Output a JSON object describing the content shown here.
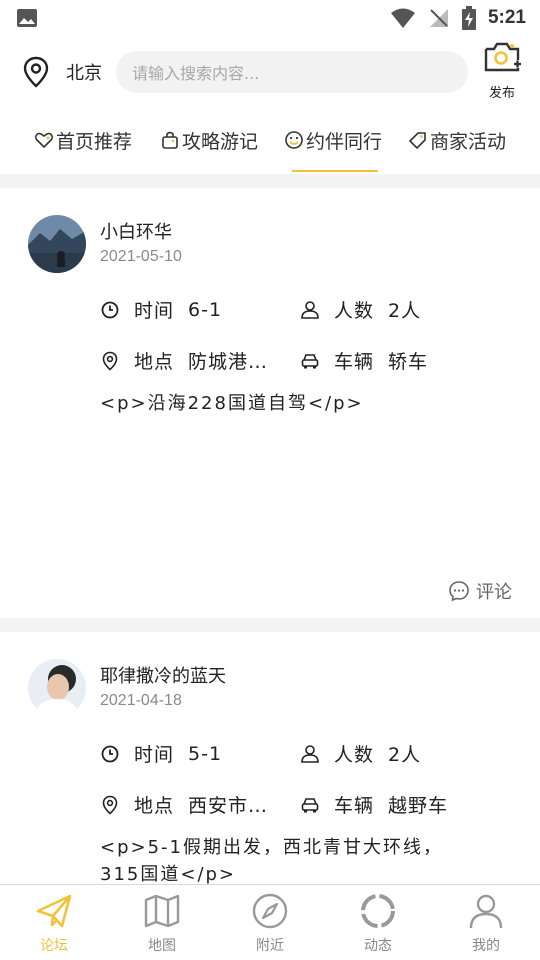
{
  "status_bar": {
    "time": "5:21"
  },
  "header": {
    "city": "北京",
    "search_placeholder": "请输入搜索内容...",
    "publish_label": "发布"
  },
  "tabs": [
    {
      "label": "首页推荐",
      "icon": "heart-icon"
    },
    {
      "label": "攻略游记",
      "icon": "bag-icon"
    },
    {
      "label": "约伴同行",
      "icon": "smile-icon",
      "active": true
    },
    {
      "label": "商家活动",
      "icon": "tag-icon"
    }
  ],
  "posts": [
    {
      "author": "小白环华",
      "date": "2021-05-10",
      "time_label": "时间",
      "time_value": "6-1",
      "people_label": "人数",
      "people_value": "2人",
      "place_label": "地点",
      "place_value": "防城港…",
      "vehicle_label": "车辆",
      "vehicle_value": "轿车",
      "content": "<p>沿海228国道自驾</p>",
      "comment_label": "评论"
    },
    {
      "author": "耶律撒冷的蓝天",
      "date": "2021-04-18",
      "time_label": "时间",
      "time_value": "5-1",
      "people_label": "人数",
      "people_value": "2人",
      "place_label": "地点",
      "place_value": "西安市…",
      "vehicle_label": "车辆",
      "vehicle_value": "越野车",
      "content": "<p>5-1假期出发，西北青甘大环线，315国道</p>"
    }
  ],
  "bottom_nav": [
    {
      "label": "论坛",
      "icon": "paper-plane-icon",
      "active": true
    },
    {
      "label": "地图",
      "icon": "map-icon"
    },
    {
      "label": "附近",
      "icon": "compass-icon"
    },
    {
      "label": "动态",
      "icon": "loading-ring-icon"
    },
    {
      "label": "我的",
      "icon": "person-icon"
    }
  ],
  "colors": {
    "accent": "#f2c23b",
    "muted": "#8a8a8a",
    "search_bg": "#f2f2f2",
    "divider": "#f4f4f4"
  }
}
